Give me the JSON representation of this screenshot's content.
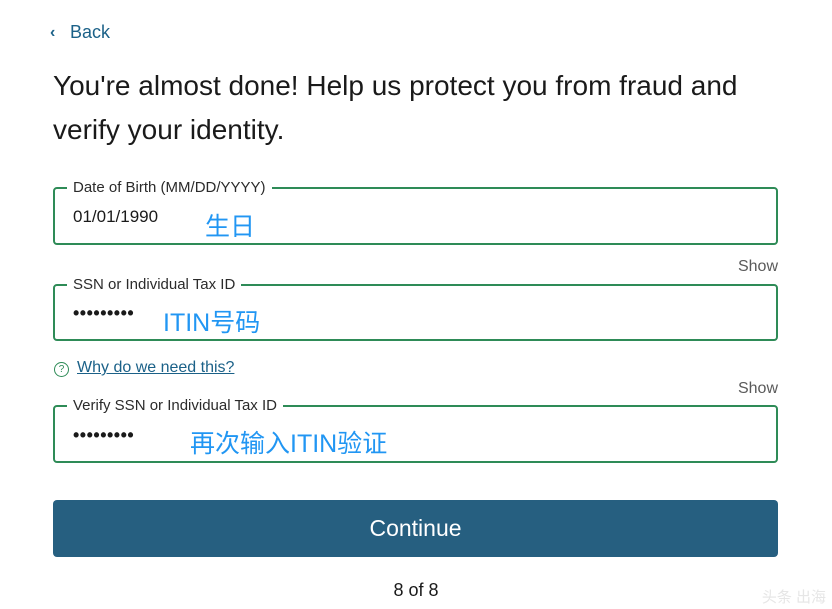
{
  "back": {
    "label": "Back",
    "icon": "chevron-left-icon"
  },
  "headline": "You're almost done! Help us protect you from fraud and verify your identity.",
  "fields": {
    "dob": {
      "label": "Date of Birth (MM/DD/YYYY)",
      "value": "01/01/1990",
      "annotation": "生日"
    },
    "ssn": {
      "label": "SSN or Individual Tax ID",
      "value": "•••••••••",
      "show_label": "Show",
      "annotation": "ITIN号码"
    },
    "verify_ssn": {
      "label": "Verify SSN or Individual Tax ID",
      "value": "•••••••••",
      "show_label": "Show",
      "annotation": "再次输入ITIN验证"
    }
  },
  "why": {
    "icon": "question-circle-icon",
    "label": "Why do we need this?"
  },
  "continue_label": "Continue",
  "progress": "8 of 8",
  "watermark": "头条 出海",
  "colors": {
    "field_border": "#2e8b57",
    "link": "#1b6188",
    "button_bg": "#265f80",
    "annotation": "#2196f3"
  }
}
